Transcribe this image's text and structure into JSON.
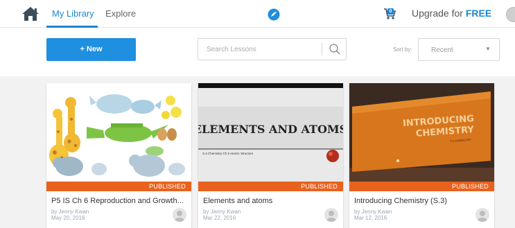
{
  "nav": {
    "tabs": [
      {
        "label": "My Library",
        "active": true
      },
      {
        "label": "Explore",
        "active": false
      }
    ],
    "cart_count": "0",
    "upgrade_prefix": "Upgrade for",
    "upgrade_emphasis": "FREE"
  },
  "toolbar": {
    "new_label": "+ New",
    "search_placeholder": "Search Lessons",
    "sort_label": "Sort by:",
    "sort_value": "Recent"
  },
  "cards": [
    {
      "title": "P5 IS Ch 6 Reproduction and Growth...",
      "status": "PUBLISHED",
      "author": "by Jenny Kwan",
      "date": "May 20, 2016"
    },
    {
      "title": "Elements and atoms",
      "status": "PUBLISHED",
      "author": "by Jenny Kwan",
      "date": "Mar 22, 2016",
      "thumb_heading": "ELEMENTS AND ATOMS",
      "thumb_subtitle": "S.3 Chemistry Ch 5 Atomic Structure"
    },
    {
      "title": "Introducing Chemistry (S.3)",
      "status": "PUBLISHED",
      "author": "by Jenny Kwan",
      "date": "Mar 12, 2016",
      "thumb_heading_1": "INTRODUCING",
      "thumb_heading_2": "CHEMISTRY",
      "thumb_subtitle": "S.3 CHEMISTRY"
    }
  ],
  "colors": {
    "accent": "#1a86d0",
    "new_button": "#1f8fe0",
    "published": "#e8621e"
  }
}
